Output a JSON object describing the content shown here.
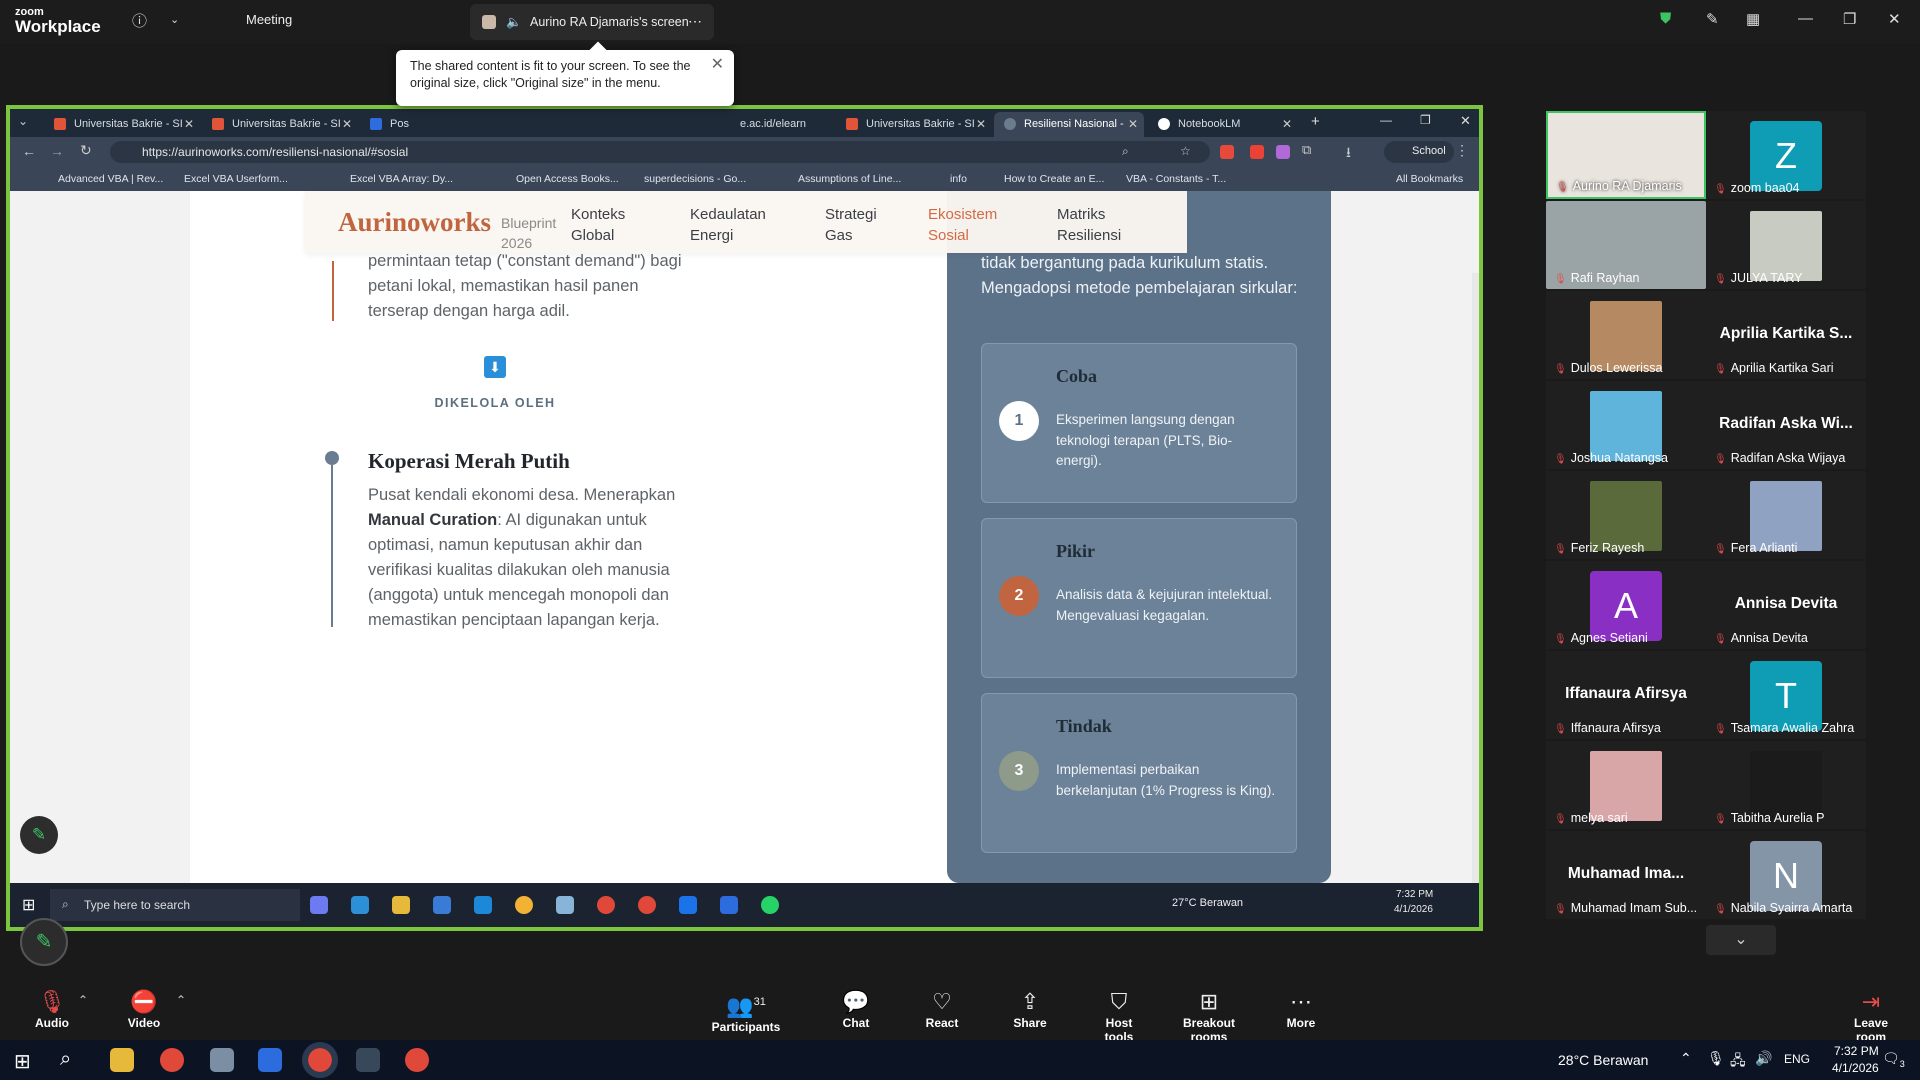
{
  "zoom": {
    "brand_small": "zoom",
    "brand": "Workplace",
    "meeting_label": "Meeting",
    "share_label": "Aurino RA Djamaris's screen",
    "tooltip": "The shared content is fit to your screen. To see the original size, click \"Original size\" in the menu."
  },
  "browser": {
    "tabs": [
      {
        "label": "Universitas Bakrie - SI"
      },
      {
        "label": "Universitas Bakrie - SI"
      },
      {
        "label": "Pos"
      },
      {
        "label": "e.ac.id/elearn"
      },
      {
        "label": "Universitas Bakrie - SI"
      },
      {
        "label": "Resiliensi Nasional - "
      },
      {
        "label": "NotebookLM"
      }
    ],
    "url": "https://aurinoworks.com/resiliensi-nasional/#sosial",
    "profile": "School",
    "bookmarks": [
      "Advanced VBA | Rev...",
      "Excel VBA Userform...",
      "Excel VBA Array: Dy...",
      "Open Access Books...",
      "superdecisions - Go...",
      "Assumptions of Line...",
      "info",
      "How to Create an E...",
      "VBA - Constants - T...",
      "All Bookmarks"
    ]
  },
  "site": {
    "brand": "Aurinoworks",
    "blueprint": "Blueprint",
    "year": "2026",
    "nav": [
      {
        "l1": "Konteks",
        "l2": "Global"
      },
      {
        "l1": "Kedaulatan",
        "l2": "Energi"
      },
      {
        "l1": "Strategi",
        "l2": "Gas"
      },
      {
        "l1": "Ekosistem",
        "l2": "Sosial"
      },
      {
        "l1": "Matriks",
        "l2": "Resiliensi"
      }
    ],
    "left_top_lines": [
      "permintaan tetap (\"constant demand\") bagi",
      "petani lokal, memastikan hasil panen",
      "terserap dengan harga adil."
    ],
    "managed_by": "DIKELOLA OLEH",
    "koperasi_title": "Koperasi Merah Putih",
    "koperasi_line1": "Pusat kendali ekonomi desa. Menerapkan",
    "koperasi_bold": "Manual Curation",
    "koperasi_after_bold": ": AI digunakan untuk",
    "koperasi_lines": [
      "optimasi, namun keputusan akhir dan",
      "verifikasi kualitas dilakukan oleh manusia",
      "(anggota) untuk mencegah monopoli dan",
      "memastikan penciptaan lapangan kerja."
    ],
    "card_intro": "tidak bergantung pada kurikulum statis. Mengadopsi metode pembelajaran sirkular:",
    "steps": [
      {
        "num": "1",
        "title": "Coba",
        "desc": "Eksperimen langsung dengan teknologi terapan (PLTS, Bio-energi)."
      },
      {
        "num": "2",
        "title": "Pikir",
        "desc": "Analisis data & kejujuran intelektual. Mengevaluasi kegagalan."
      },
      {
        "num": "3",
        "title": "Tindak",
        "desc": "Implementasi perbaikan berkelanjutan (1% Progress is King)."
      }
    ]
  },
  "inner_taskbar": {
    "search": "Type here to search",
    "weather": "27°C  Berawan",
    "time": "7:32 PM",
    "date": "4/1/2026"
  },
  "participants": [
    {
      "name": "Aurino RA Djamaris"
    },
    {
      "name": "zoom baa04",
      "initial": "Z"
    },
    {
      "name": "Rafi Rayhan"
    },
    {
      "name": "JULYA TARY"
    },
    {
      "name": "Dulos Lewerissa"
    },
    {
      "name": "Aprilia Kartika Sari",
      "display": "Aprilia Kartika S..."
    },
    {
      "name": "Joshua Natangsa"
    },
    {
      "name": "Radifan Aska Wijaya",
      "display": "Radifan Aska Wi..."
    },
    {
      "name": "Feriz Rayesh"
    },
    {
      "name": "Fera Arlianti"
    },
    {
      "name": "Agnes Setiani",
      "initial": "A"
    },
    {
      "name": "Annisa Devita",
      "display": "Annisa Devita"
    },
    {
      "name": "Iffanaura Afirsya",
      "display": "Iffanaura Afirsya"
    },
    {
      "name": "Tsamara Awalia Zahra",
      "initial": "T"
    },
    {
      "name": "melya sari"
    },
    {
      "name": "Tabitha Aurelia P"
    },
    {
      "name": "Muhamad Imam Sub...",
      "display": "Muhamad Ima..."
    },
    {
      "name": "Nabila Syairra Amarta",
      "initial": "N"
    }
  ],
  "toolbar": {
    "audio": "Audio",
    "video": "Video",
    "participants": "Participants",
    "participants_count": "31",
    "chat": "Chat",
    "react": "React",
    "share": "Share",
    "host_tools": "Host tools",
    "breakout": "Breakout rooms",
    "more": "More",
    "leave": "Leave room"
  },
  "taskbar": {
    "weather": "28°C  Berawan",
    "lang": "ENG",
    "time": "7:32 PM",
    "date": "4/1/2026",
    "notif": "3"
  },
  "colors": {
    "accent": "#d46a45",
    "share_border": "#7cc63f",
    "card": "#5c7289"
  }
}
